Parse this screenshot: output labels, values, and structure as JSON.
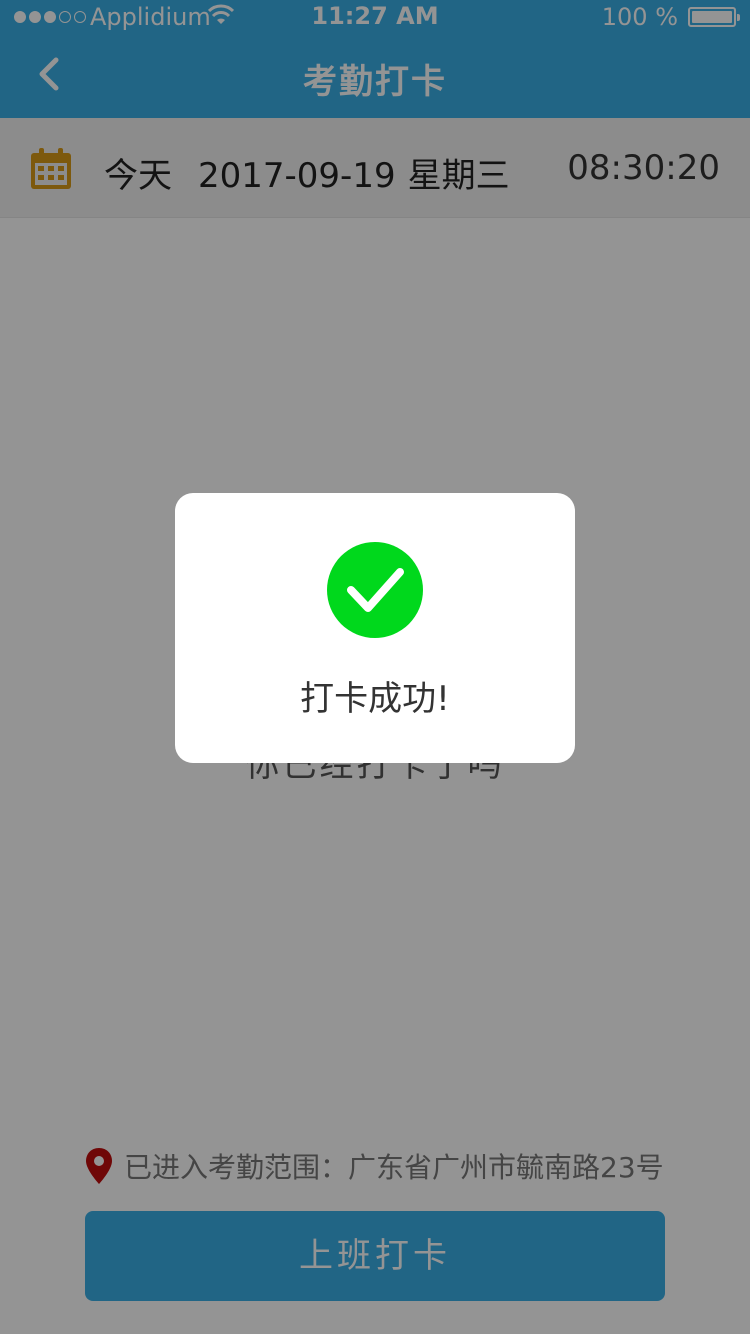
{
  "status_bar": {
    "carrier": "Applidium",
    "time": "11:27 AM",
    "battery": "100 %"
  },
  "header": {
    "title": "考勤打卡"
  },
  "date_row": {
    "today_label": "今天",
    "date": "2017-09-19",
    "weekday": "星期三",
    "time": "08:30:20"
  },
  "content": {
    "obscured_text": "你已经打卡了吗"
  },
  "location": {
    "text": "已进入考勤范围：广东省广州市毓南路23号"
  },
  "actions": {
    "clock_in_label": "上班打卡"
  },
  "dialog": {
    "message": "打卡成功!"
  },
  "colors": {
    "accent": "#3aaee6",
    "success": "#00d81c",
    "pin": "#c00d0d",
    "calendar": "#d79a18"
  },
  "icons": [
    "back-chevron-icon",
    "calendar-icon",
    "location-pin-icon",
    "success-check-icon",
    "wifi-icon",
    "battery-icon"
  ]
}
